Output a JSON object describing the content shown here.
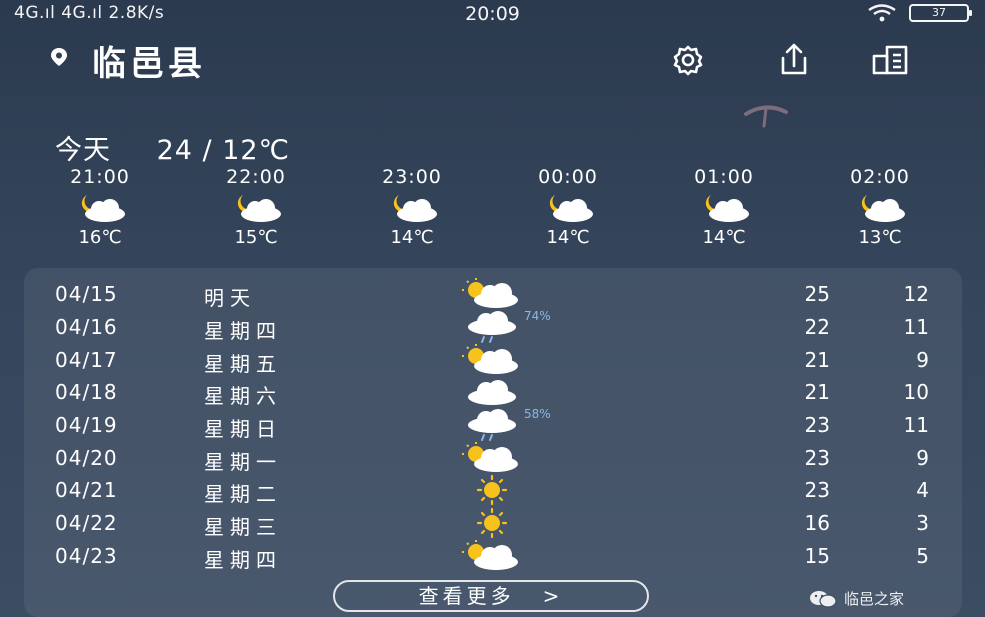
{
  "status_bar": {
    "left": "4G.ıl 4G.ıl 2.8K/s",
    "time": "20:09",
    "battery": "37"
  },
  "header": {
    "city": "临邑县"
  },
  "today": {
    "label": "今天",
    "range": "24 / 12℃"
  },
  "hourly": [
    {
      "time": "21:00",
      "icon": "partly-cloudy-night-icon",
      "temp": "16℃"
    },
    {
      "time": "22:00",
      "icon": "partly-cloudy-night-icon",
      "temp": "15℃"
    },
    {
      "time": "23:00",
      "icon": "partly-cloudy-night-icon",
      "temp": "14℃"
    },
    {
      "time": "00:00",
      "icon": "partly-cloudy-night-icon",
      "temp": "14℃"
    },
    {
      "time": "01:00",
      "icon": "partly-cloudy-night-icon",
      "temp": "14℃"
    },
    {
      "time": "02:00",
      "icon": "partly-cloudy-night-icon",
      "temp": "13℃"
    }
  ],
  "daily": [
    {
      "date": "04/15",
      "day": "明天",
      "icon": "partly-cloudy-icon",
      "pct": "",
      "high": "25",
      "low": "12"
    },
    {
      "date": "04/16",
      "day": "星期四",
      "icon": "light-rain-icon",
      "pct": "74%",
      "high": "22",
      "low": "11"
    },
    {
      "date": "04/17",
      "day": "星期五",
      "icon": "partly-cloudy-icon",
      "pct": "",
      "high": "21",
      "low": "9"
    },
    {
      "date": "04/18",
      "day": "星期六",
      "icon": "cloudy-icon",
      "pct": "",
      "high": "21",
      "low": "10"
    },
    {
      "date": "04/19",
      "day": "星期日",
      "icon": "light-rain-icon",
      "pct": "58%",
      "high": "23",
      "low": "11"
    },
    {
      "date": "04/20",
      "day": "星期一",
      "icon": "partly-cloudy-icon",
      "pct": "",
      "high": "23",
      "low": "9"
    },
    {
      "date": "04/21",
      "day": "星期二",
      "icon": "sunny-icon",
      "pct": "",
      "high": "23",
      "low": "4"
    },
    {
      "date": "04/22",
      "day": "星期三",
      "icon": "sunny-icon",
      "pct": "",
      "high": "16",
      "low": "3"
    },
    {
      "date": "04/23",
      "day": "星期四",
      "icon": "partly-cloudy-icon",
      "pct": "",
      "high": "15",
      "low": "5"
    }
  ],
  "more_button": {
    "label": "查看更多",
    "chevron": ">"
  },
  "watermark": {
    "text": "临邑之家"
  },
  "colors": {
    "background_top": "#2b3a4e",
    "background_bottom": "#3c4c62",
    "sun": "#f7c21b",
    "percent": "#8ab8e6"
  }
}
